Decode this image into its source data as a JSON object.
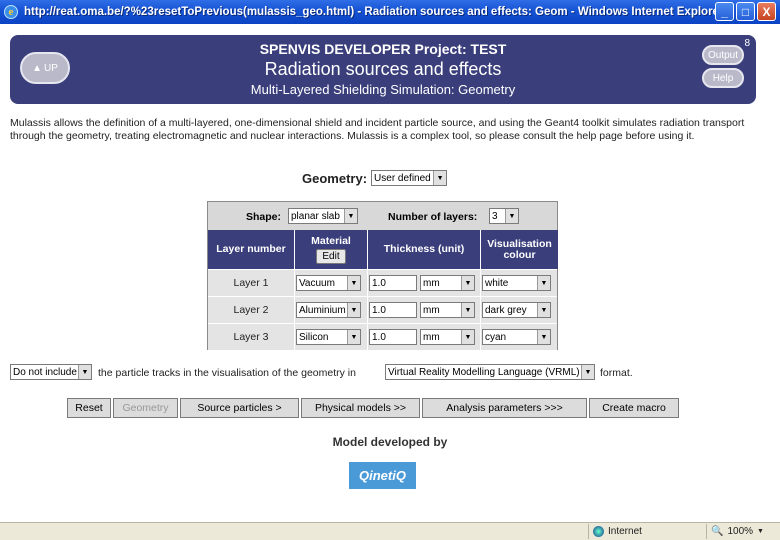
{
  "window": {
    "title": "http://reat.oma.be/?%23resetToPrevious(mulassis_geo.html) - Radiation sources and effects: Geom - Windows Internet Explorer",
    "controls": [
      "_",
      "□",
      "X"
    ]
  },
  "banner": {
    "project": "SPENVIS DEVELOPER Project: TEST",
    "section": "Radiation sources and effects",
    "subtitle": "Multi-Layered Shielding Simulation: Geometry",
    "up_label": "UP",
    "output_label": "Output",
    "help_label": "Help",
    "page_number": "8"
  },
  "intro": "Mulassis allows the definition of a multi-layered, one-dimensional shield and incident particle source, and using the Geant4 toolkit simulates radiation transport through the geometry, treating electromagnetic and nuclear interactions. Mulassis is a complex tool, so please consult the help page before using it.",
  "geometry": {
    "label": "Geometry:",
    "selected": "User defined"
  },
  "table": {
    "shape_label": "Shape:",
    "shape_value": "planar slab",
    "layers_label": "Number of layers:",
    "layers_value": "3",
    "headers": {
      "layer_number": "Layer number",
      "material": "Material",
      "edit": "Edit",
      "thickness": "Thickness (unit)",
      "vis1": "Visualisation",
      "vis2": "colour"
    },
    "rows": [
      {
        "name": "Layer 1",
        "material": "Vacuum",
        "thickness": "1.0",
        "unit": "mm",
        "colour": "white"
      },
      {
        "name": "Layer 2",
        "material": "Aluminium",
        "thickness": "1.0",
        "unit": "mm",
        "colour": "dark grey"
      },
      {
        "name": "Layer 3",
        "material": "Silicon",
        "thickness": "1.0",
        "unit": "mm",
        "colour": "cyan"
      }
    ]
  },
  "tracks": {
    "include_value": "Do not include",
    "middle_text": "the particle tracks in the visualisation of the geometry in",
    "format_value": "Virtual Reality Modelling Language (VRML)",
    "end_text": "format."
  },
  "buttons": {
    "reset": "Reset",
    "geometry": "Geometry",
    "source": "Source particles >",
    "physical": "Physical models >>",
    "analysis": "Analysis parameters >>>",
    "macro": "Create macro"
  },
  "model_text": "Model developed by",
  "logo_text": "QinetiQ",
  "status": {
    "zone": "Internet",
    "zoom": "100%"
  }
}
